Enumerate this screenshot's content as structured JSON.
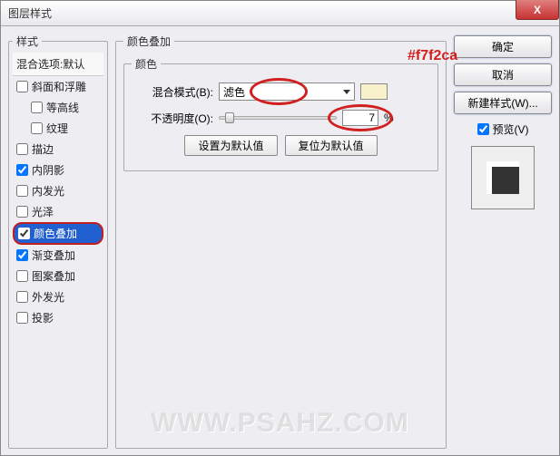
{
  "window": {
    "title": "图层样式"
  },
  "close": "X",
  "styles_panel": {
    "legend": "样式",
    "blending_header": "混合选项:默认",
    "items": [
      {
        "label": "斜面和浮雕",
        "checked": false
      },
      {
        "label": "等高线",
        "checked": false,
        "indent": true
      },
      {
        "label": "纹理",
        "checked": false,
        "indent": true
      },
      {
        "label": "描边",
        "checked": false
      },
      {
        "label": "内阴影",
        "checked": true
      },
      {
        "label": "内发光",
        "checked": false
      },
      {
        "label": "光泽",
        "checked": false
      },
      {
        "label": "颜色叠加",
        "checked": true,
        "selected": true
      },
      {
        "label": "渐变叠加",
        "checked": true
      },
      {
        "label": "图案叠加",
        "checked": false
      },
      {
        "label": "外发光",
        "checked": false
      },
      {
        "label": "投影",
        "checked": false
      }
    ]
  },
  "center": {
    "legend": "颜色叠加",
    "inner_legend": "颜色",
    "blend_mode_label": "混合模式(B):",
    "blend_mode_value": "滤色",
    "color_hex": "#f7f2ca",
    "opacity_label": "不透明度(O):",
    "opacity_value": "7",
    "opacity_unit": "%",
    "set_default": "设置为默认值",
    "reset_default": "复位为默认值"
  },
  "right": {
    "ok": "确定",
    "cancel": "取消",
    "new_style": "新建样式(W)...",
    "preview_label": "预览(V)"
  },
  "watermark": "WWW.PSAHZ.COM"
}
